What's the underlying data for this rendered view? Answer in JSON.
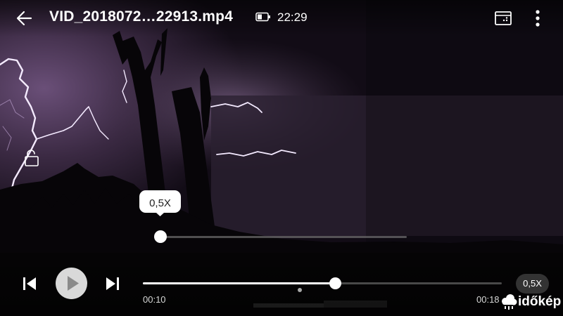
{
  "video": {
    "filename": "VID_2018072…22913.mp4",
    "clock": "22:29",
    "current_time": "00:10",
    "total_time": "00:18",
    "progress_fraction": 0.535
  },
  "speed": {
    "bubble_label": "0,5X",
    "chip_label": "0,5X",
    "slider_fraction": 0.0
  },
  "watermark": {
    "text": "időkép"
  },
  "icons": {
    "back": "back-arrow-icon",
    "battery": "battery-icon",
    "pip": "picture-in-picture-icon",
    "more": "more-vertical-icon",
    "lock": "unlock-icon",
    "prev": "skip-previous-icon",
    "play": "play-icon",
    "next": "skip-next-icon"
  },
  "colors": {
    "accent": "#ffffff",
    "sky_glow": "#5b4266",
    "lightning": "#f3e9ff"
  }
}
